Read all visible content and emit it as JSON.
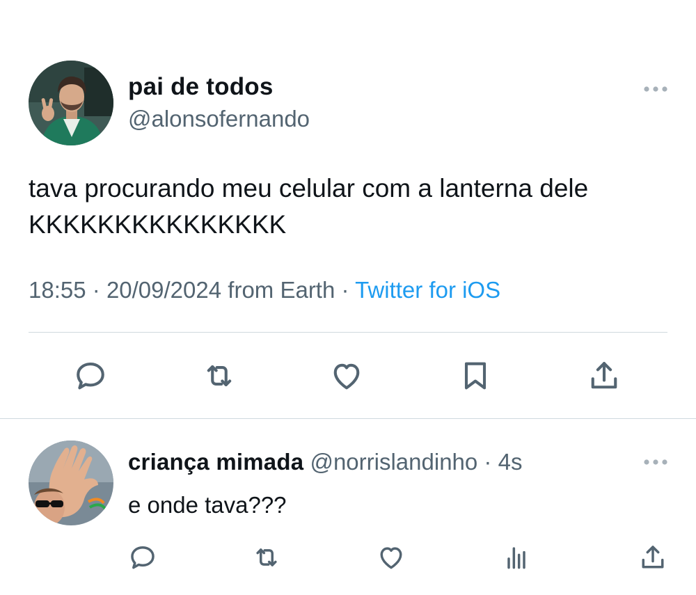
{
  "tweet": {
    "display_name": "pai de todos",
    "handle": "@alonsofernando",
    "text": "tava procurando meu celular com a lanterna dele\nKKKKKKKKKKKKKKK",
    "time": "18:55",
    "date": "20/09/2024",
    "location": "from Earth",
    "separator": "·",
    "source": "Twitter for iOS",
    "actions": [
      "reply-icon",
      "retweet-icon",
      "like-icon",
      "bookmark-icon",
      "share-icon"
    ]
  },
  "reply": {
    "display_name": "criança mimada",
    "handle": "@norrislandinho",
    "separator": "·",
    "time": "4s",
    "text": "e onde tava???",
    "actions": [
      "reply-icon",
      "retweet-icon",
      "like-icon",
      "views-icon",
      "share-icon"
    ]
  },
  "colors": {
    "text_primary": "#0f1419",
    "text_secondary": "#536471",
    "link": "#1d9bf0",
    "divider": "#cfd9de"
  }
}
